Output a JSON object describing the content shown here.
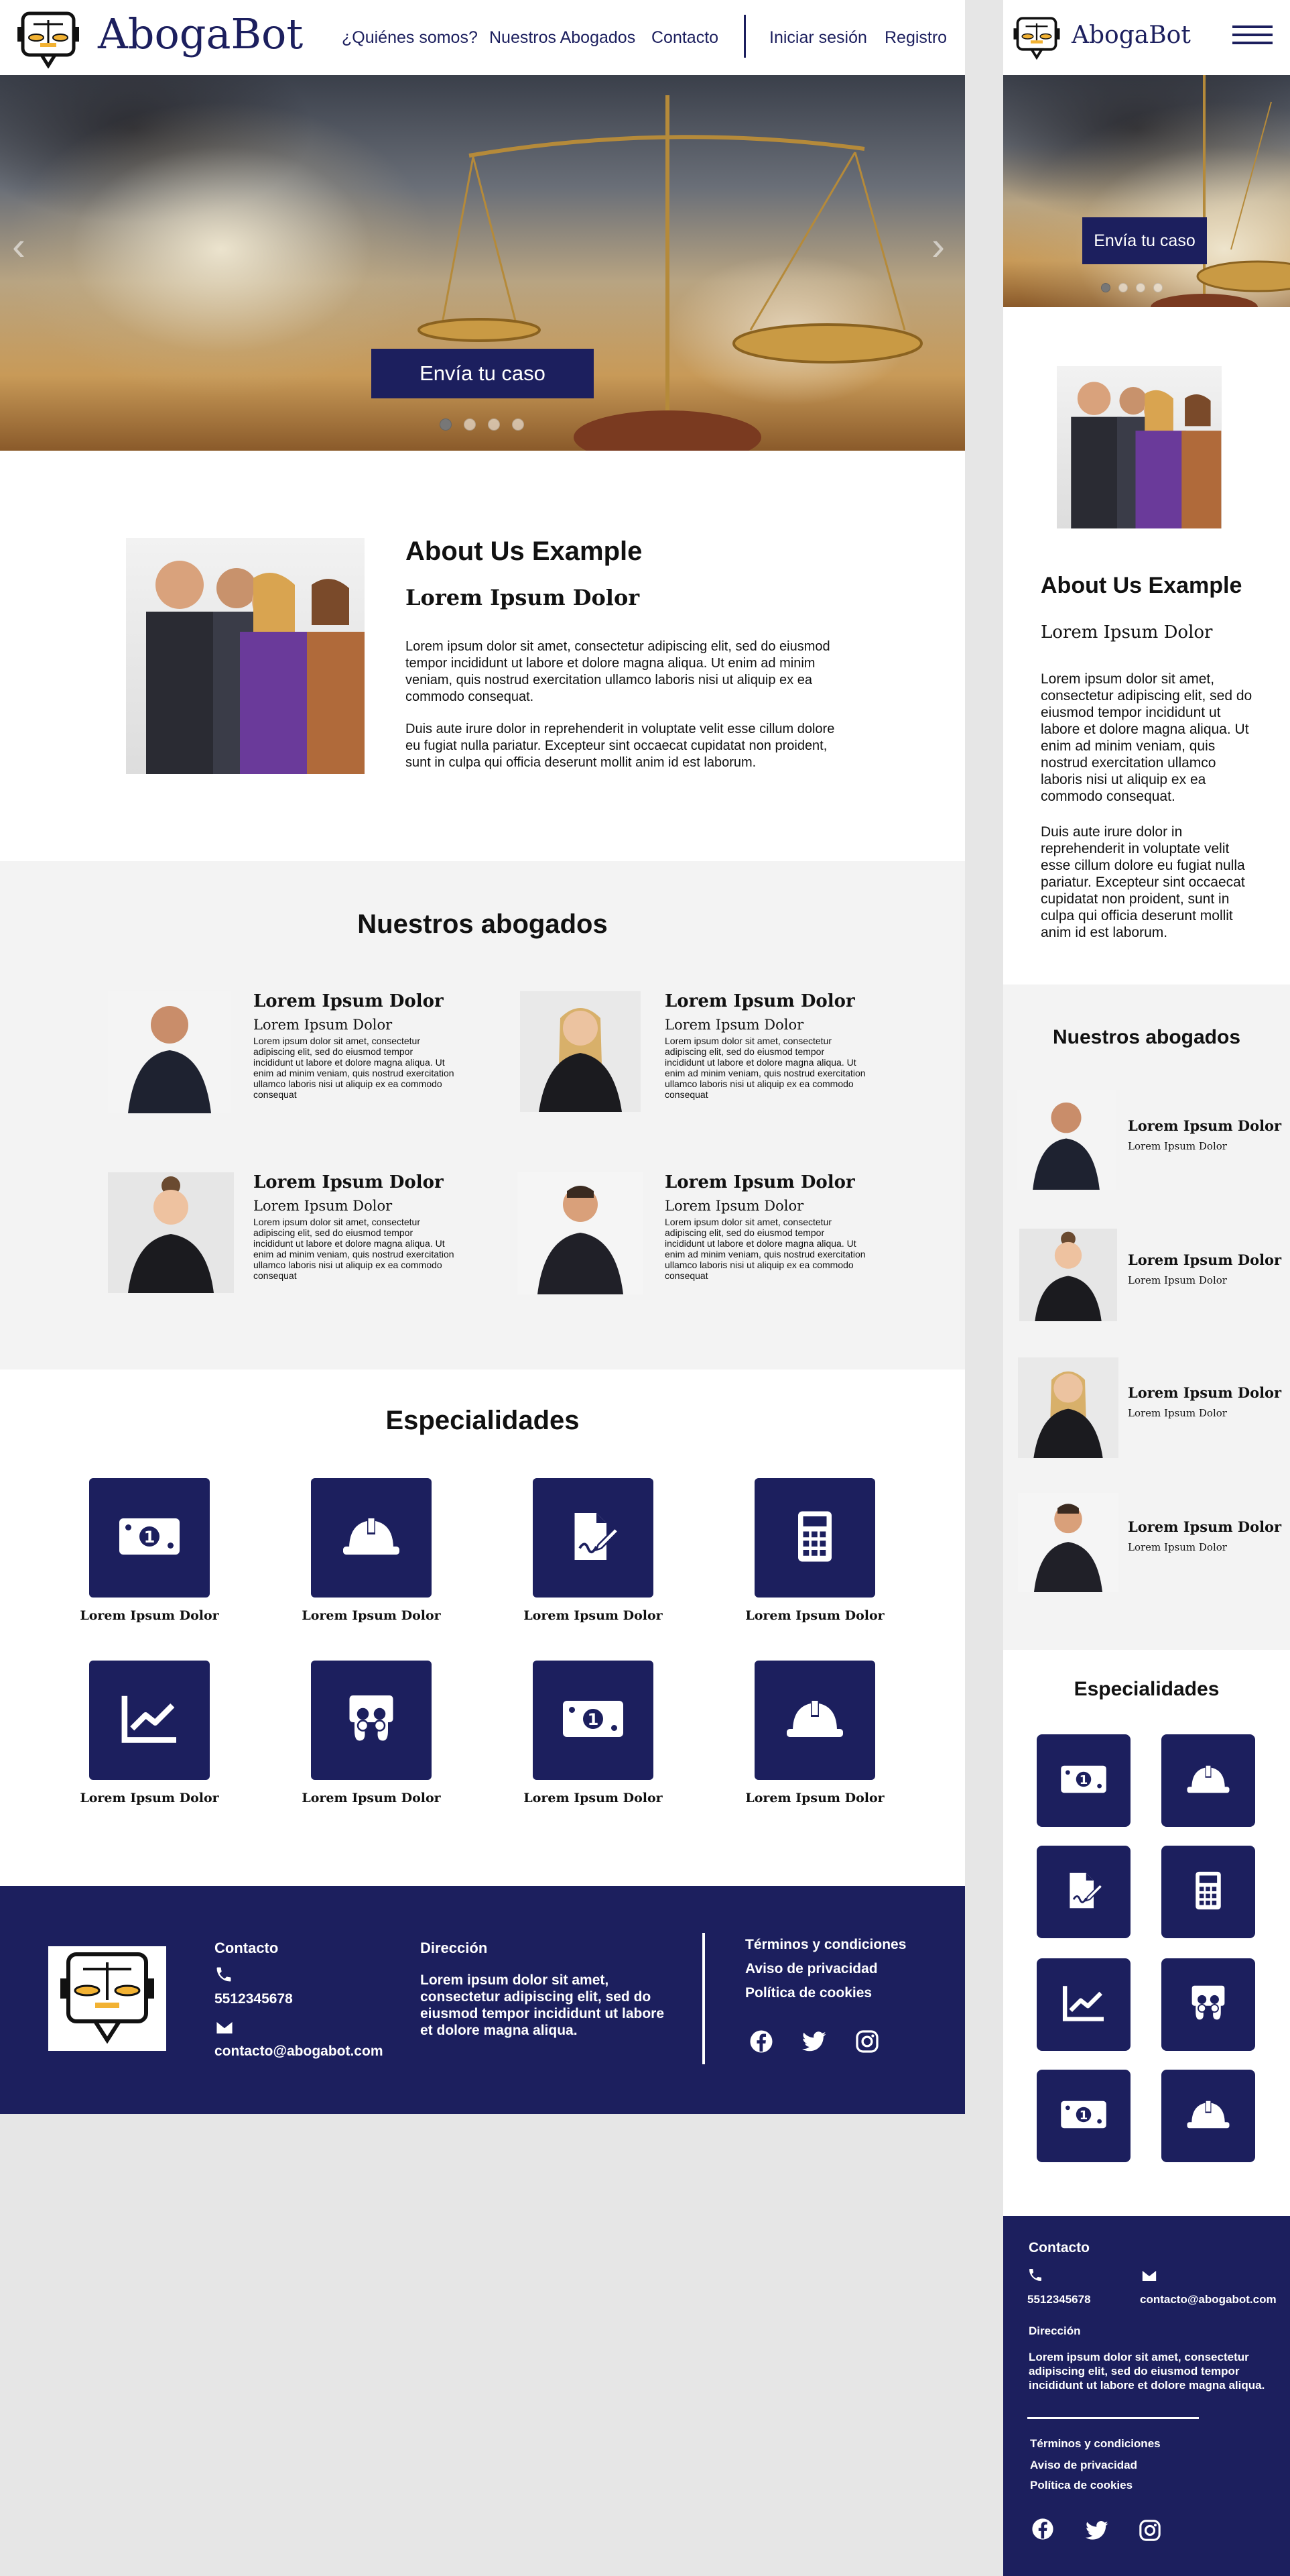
{
  "brand": {
    "name": "AbogaBot",
    "primary_color": "#1c1f5e",
    "accent_color": "#f2b233"
  },
  "nav": {
    "items": [
      "¿Quiénes somos?",
      "Nuestros Abogados",
      "Contacto"
    ],
    "login": "Iniciar sesión",
    "register": "Registro"
  },
  "hero": {
    "cta": "Envía tu caso",
    "slides": 4,
    "active_slide": 1
  },
  "about": {
    "title": "About Us Example",
    "subtitle": "Lorem Ipsum Dolor",
    "p1": "Lorem ipsum dolor sit amet, consectetur adipiscing elit, sed do eiusmod tempor incididunt ut labore et dolore magna aliqua. Ut enim ad minim veniam, quis nostrud exercitation ullamco laboris nisi ut aliquip ex ea commodo consequat.",
    "p2": "Duis aute irure dolor in reprehenderit in voluptate velit esse cillum dolore eu fugiat nulla pariatur. Excepteur sint occaecat cupidatat non proident, sunt in culpa qui officia deserunt mollit anim id est laborum."
  },
  "lawyers": {
    "title": "Nuestros abogados",
    "items": [
      {
        "name": "Lorem Ipsum Dolor",
        "sub": "Lorem Ipsum Dolor",
        "text": "Lorem ipsum dolor sit amet, consectetur adipiscing elit, sed do eiusmod tempor incididunt ut labore et dolore magna aliqua. Ut enim ad minim veniam, quis nostrud exercitation ullamco laboris nisi ut aliquip ex ea commodo consequat"
      },
      {
        "name": "Lorem Ipsum Dolor",
        "sub": "Lorem Ipsum Dolor",
        "text": "Lorem ipsum dolor sit amet, consectetur adipiscing elit, sed do eiusmod tempor incididunt ut labore et dolore magna aliqua. Ut enim ad minim veniam, quis nostrud exercitation ullamco laboris nisi ut aliquip ex ea commodo consequat"
      },
      {
        "name": "Lorem Ipsum Dolor",
        "sub": "Lorem Ipsum Dolor",
        "text": "Lorem ipsum dolor sit amet, consectetur adipiscing elit, sed do eiusmod tempor incididunt ut labore et dolore magna aliqua. Ut enim ad minim veniam, quis nostrud exercitation ullamco laboris nisi ut aliquip ex ea commodo consequat"
      },
      {
        "name": "Lorem Ipsum Dolor",
        "sub": "Lorem Ipsum Dolor",
        "text": "Lorem ipsum dolor sit amet, consectetur adipiscing elit, sed do eiusmod tempor incididunt ut labore et dolore magna aliqua. Ut enim ad minim veniam, quis nostrud exercitation ullamco laboris nisi ut aliquip ex ea commodo consequat"
      }
    ]
  },
  "specialties": {
    "title": "Especialidades",
    "items": [
      {
        "label": "Lorem Ipsum Dolor",
        "icon": "money-bill-icon"
      },
      {
        "label": "Lorem Ipsum Dolor",
        "icon": "hard-hat-icon"
      },
      {
        "label": "Lorem Ipsum Dolor",
        "icon": "signed-document-icon"
      },
      {
        "label": "Lorem Ipsum Dolor",
        "icon": "calculator-icon"
      },
      {
        "label": "Lorem Ipsum Dolor",
        "icon": "chart-line-icon"
      },
      {
        "label": "Lorem Ipsum Dolor",
        "icon": "slideshare-icon"
      },
      {
        "label": "Lorem Ipsum Dolor",
        "icon": "money-bill-icon"
      },
      {
        "label": "Lorem Ipsum Dolor",
        "icon": "hard-hat-icon"
      }
    ]
  },
  "footer": {
    "contact_label": "Contacto",
    "phone": "5512345678",
    "email": "contacto@abogabot.com",
    "address_label": "Dirección",
    "address": "Lorem ipsum dolor sit amet, consectetur adipiscing elit, sed do eiusmod tempor incididunt ut labore et dolore magna aliqua.",
    "links": [
      "Términos y condiciones",
      "Aviso de privacidad",
      "Política de cookies"
    ],
    "social_icons": [
      "facebook-icon",
      "twitter-icon",
      "instagram-icon"
    ]
  }
}
